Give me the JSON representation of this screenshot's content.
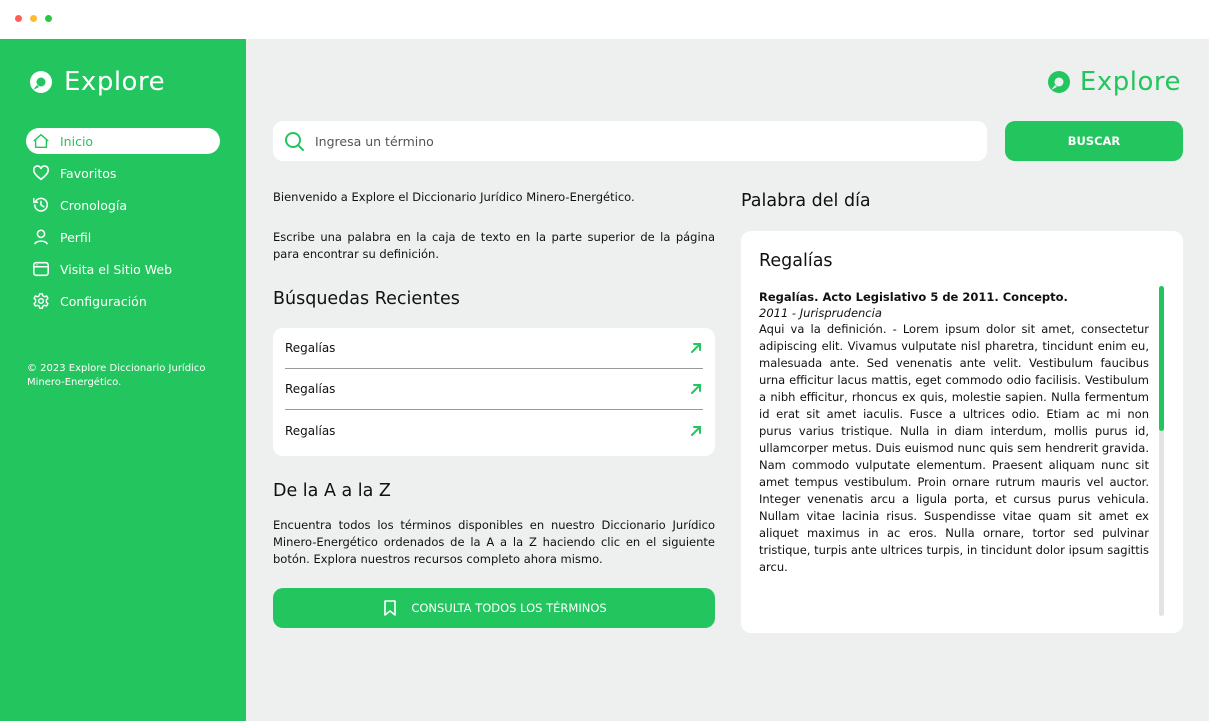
{
  "window": {
    "dots": [
      "#ff5f57",
      "#febc2e",
      "#28c840"
    ]
  },
  "colors": {
    "accent": "#23c55e",
    "background": "#eef0f0"
  },
  "sidebar": {
    "brand": "Explore",
    "items": [
      {
        "label": "Inicio",
        "icon": "home-icon",
        "active": true
      },
      {
        "label": "Favoritos",
        "icon": "heart-icon"
      },
      {
        "label": "Cronología",
        "icon": "history-icon"
      },
      {
        "label": "Perfil",
        "icon": "user-icon"
      },
      {
        "label": "Visita el Sitio Web",
        "icon": "browser-icon"
      },
      {
        "label": "Configuración",
        "icon": "gear-icon"
      }
    ],
    "copyright": "© 2023 Explore Diccionario Jurídico Minero-Energético."
  },
  "header": {
    "brand": "Explore"
  },
  "search": {
    "placeholder": "Ingresa un término",
    "button_label": "BUSCAR"
  },
  "intro": {
    "welcome": "Bienvenido a Explore el Diccionario Jurídico Minero-Energético.",
    "instructions": "Escribe una palabra en la caja de texto en la parte superior de la página para encontrar su definición."
  },
  "recent": {
    "title": "Búsquedas Recientes",
    "items": [
      "Regalías",
      "Regalías",
      "Regalías"
    ]
  },
  "az": {
    "title": "De la A a la Z",
    "text": "Encuentra todos los términos disponibles en nuestro Diccionario Jurídico Minero-Energético ordenados de la A a la Z haciendo clic en el siguiente botón. Explora nuestros recursos completo ahora mismo.",
    "button_label": "CONSULTA TODOS LOS TÉRMINOS"
  },
  "word_of_day": {
    "title": "Palabra del día",
    "word": "Regalías",
    "entry_title": "Regalías. Acto Legislativo 5 de 2011. Concepto.",
    "entry_subtitle": "2011 - Jurisprudencia",
    "definition": "Aqui va la definición. - Lorem ipsum dolor sit amet, consectetur adipiscing elit. Vivamus vulputate nisl pharetra, tincidunt enim eu, malesuada ante. Sed venenatis ante velit. Vestibulum faucibus urna efficitur lacus mattis, eget commodo odio facilisis. Vestibulum a nibh efficitur, rhoncus ex quis, molestie sapien. Nulla fermentum id erat sit amet iaculis. Fusce a ultrices odio. Etiam ac mi non purus varius tristique. Nulla in diam interdum, mollis purus id, ullamcorper metus. Duis euismod nunc quis sem hendrerit gravida. Nam commodo vulputate elementum. Praesent aliquam nunc sit amet tempus vestibulum. Proin ornare rutrum mauris vel auctor. Integer venenatis arcu a ligula porta, et cursus purus vehicula. Nullam vitae lacinia risus. Suspendisse vitae quam sit amet ex aliquet maximus in ac eros. Nulla ornare, tortor sed pulvinar tristique, turpis ante ultrices turpis, in tincidunt dolor ipsum sagittis arcu."
  }
}
